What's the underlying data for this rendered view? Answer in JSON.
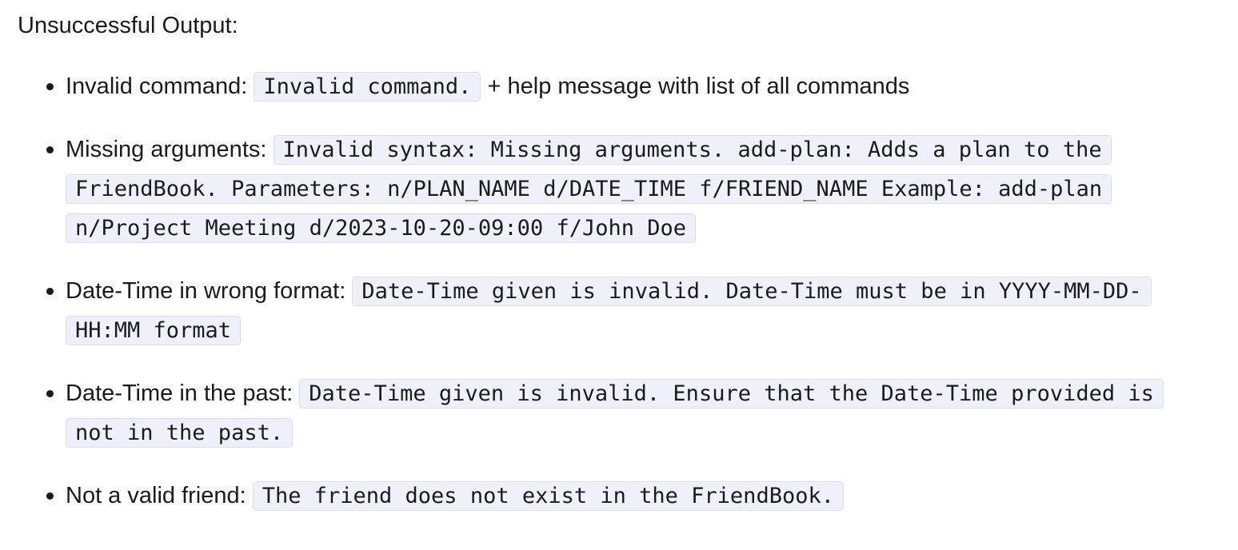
{
  "heading": "Unsuccessful Output:",
  "items": [
    {
      "label": "Invalid command:",
      "code": "Invalid command.",
      "suffix": "+ help message with list of all commands"
    },
    {
      "label": "Missing arguments:",
      "code": "Invalid syntax: Missing arguments. add-plan: Adds a plan to the FriendBook. Parameters: n/PLAN_NAME d/DATE_TIME f/FRIEND_NAME Example: add-plan n/Project Meeting d/2023-10-20-09:00 f/John Doe"
    },
    {
      "label": "Date-Time in wrong format:",
      "code": "Date-Time given is invalid. Date-Time must be in YYYY-MM-DD-HH:MM format"
    },
    {
      "label": "Date-Time in the past:",
      "code": "Date-Time given is invalid. Ensure that the Date-Time provided is not in the past."
    },
    {
      "label": "Not a valid friend:",
      "code": "The friend does not exist in the FriendBook."
    }
  ]
}
